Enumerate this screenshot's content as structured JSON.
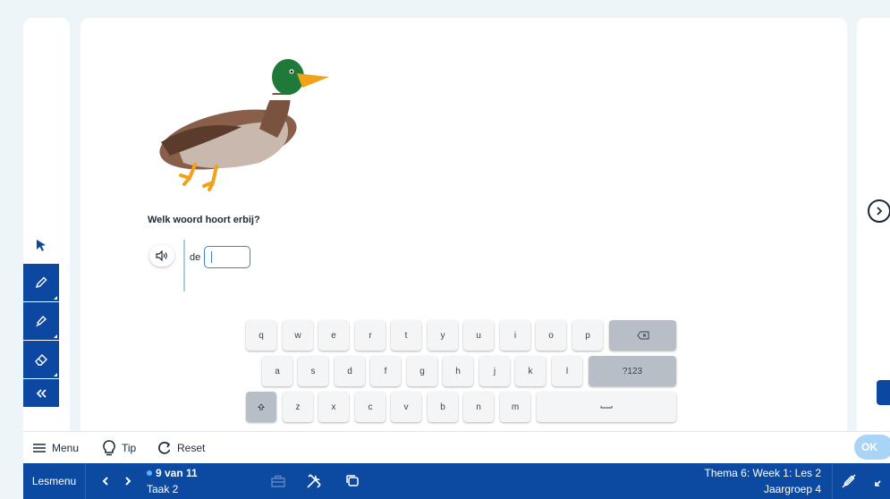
{
  "exercise": {
    "question": "Welk woord hoort erbij?",
    "article": "de",
    "answer_value": ""
  },
  "keyboard": {
    "row1": [
      "q",
      "w",
      "e",
      "r",
      "t",
      "y",
      "u",
      "i",
      "o",
      "p"
    ],
    "row2": [
      "a",
      "s",
      "d",
      "f",
      "g",
      "h",
      "j",
      "k",
      "l"
    ],
    "row3": [
      "z",
      "x",
      "c",
      "v",
      "b",
      "n",
      "m"
    ],
    "numbers_label": "?123"
  },
  "bottom_bar": {
    "menu_label": "Menu",
    "tip_label": "Tip",
    "reset_label": "Reset",
    "ok_label": "OK"
  },
  "nav_bar": {
    "lesmenu_label": "Lesmenu",
    "progress": "9 van 11",
    "task": "Taak 2",
    "theme": "Thema 6: Week 1: Les 2",
    "group": "Jaargroep 4"
  },
  "colors": {
    "primary": "#0b4aa0",
    "accent": "#3b82c9",
    "ok_disabled": "#a9d4f5"
  }
}
